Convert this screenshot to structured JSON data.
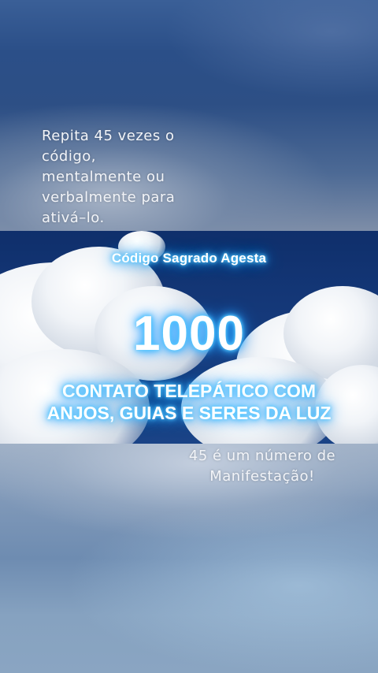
{
  "caption_top": {
    "lines": [
      "Repita 45 vezes o",
      "código,",
      "mentalmente ou",
      "verbalmente para",
      "ativá–lo."
    ]
  },
  "overlay": {
    "subtitle": "Código Sagrado Agesta",
    "number": "1000",
    "headline_lines": [
      "CONTATO TELEPÁTICO COM",
      "ANJOS, GUIAS E SERES DA LUZ"
    ]
  },
  "caption_bottom": {
    "lines": [
      "45 é um número de",
      "Manifestação!"
    ]
  },
  "colors": {
    "glow": "#3cb8ff",
    "sky_dark": "#0f2f6b",
    "caption_text": "#f2f4f8"
  }
}
